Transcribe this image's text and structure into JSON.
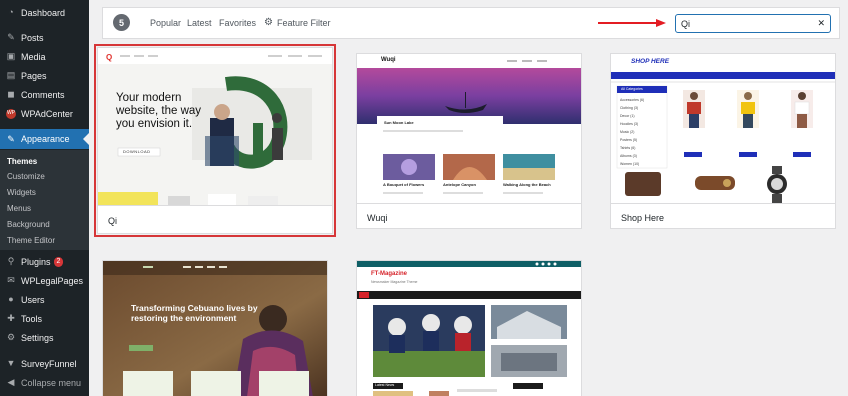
{
  "sidebar": {
    "items": [
      {
        "label": "Dashboard"
      },
      {
        "label": "Posts"
      },
      {
        "label": "Media"
      },
      {
        "label": "Pages"
      },
      {
        "label": "Comments"
      },
      {
        "label": "WPAdCenter"
      },
      {
        "label": "Appearance"
      },
      {
        "label": "Plugins",
        "badge": "2"
      },
      {
        "label": "WPLegalPages"
      },
      {
        "label": "Users"
      },
      {
        "label": "Tools"
      },
      {
        "label": "Settings"
      },
      {
        "label": "SurveyFunnel"
      },
      {
        "label": "Collapse menu"
      }
    ],
    "appearance_sub": [
      "Themes",
      "Customize",
      "Widgets",
      "Menus",
      "Background",
      "Theme Editor"
    ],
    "wpadcenter_icon_text": "WP"
  },
  "filter": {
    "count": "5",
    "tabs": [
      "Popular",
      "Latest",
      "Favorites"
    ],
    "feature_filter": "Feature Filter",
    "search_value": "Qi"
  },
  "themes": [
    {
      "name": "Qi",
      "selected": true,
      "preview": {
        "headline": "Your modern website, the way you envision it.",
        "cta": "DOWNLOAD",
        "logo": "Qi"
      }
    },
    {
      "name": "Wuqi",
      "preview": {
        "brand": "Wuqi",
        "post_title": "Sun Moon Lake",
        "cards": [
          "A Bouquet of Flowers",
          "Antelope Canyon",
          "Walking Along the Beach"
        ]
      }
    },
    {
      "name": "Shop Here",
      "preview": {
        "logo": "SHOP HERE",
        "categories_title": "All Categories",
        "categories": [
          "Accessories (6)",
          "Clothing (3)",
          "Decor (1)",
          "Hoodies (3)",
          "Music (2)",
          "Posters (5)",
          "Tshirts (6)",
          "Albums (3)",
          "Women (10)"
        ]
      }
    },
    {
      "name": "",
      "preview": {
        "headline": "Transforming Cebuano lives by restoring the environment"
      }
    },
    {
      "name": "",
      "preview": {
        "brand": "FT-Magazine",
        "tagline": "Newsmaker Magazine Theme",
        "latest_label": "Latest News"
      }
    }
  ],
  "colors": {
    "accent": "#2271b1",
    "sidebar_bg": "#1d2327",
    "highlight": "#d63638"
  }
}
